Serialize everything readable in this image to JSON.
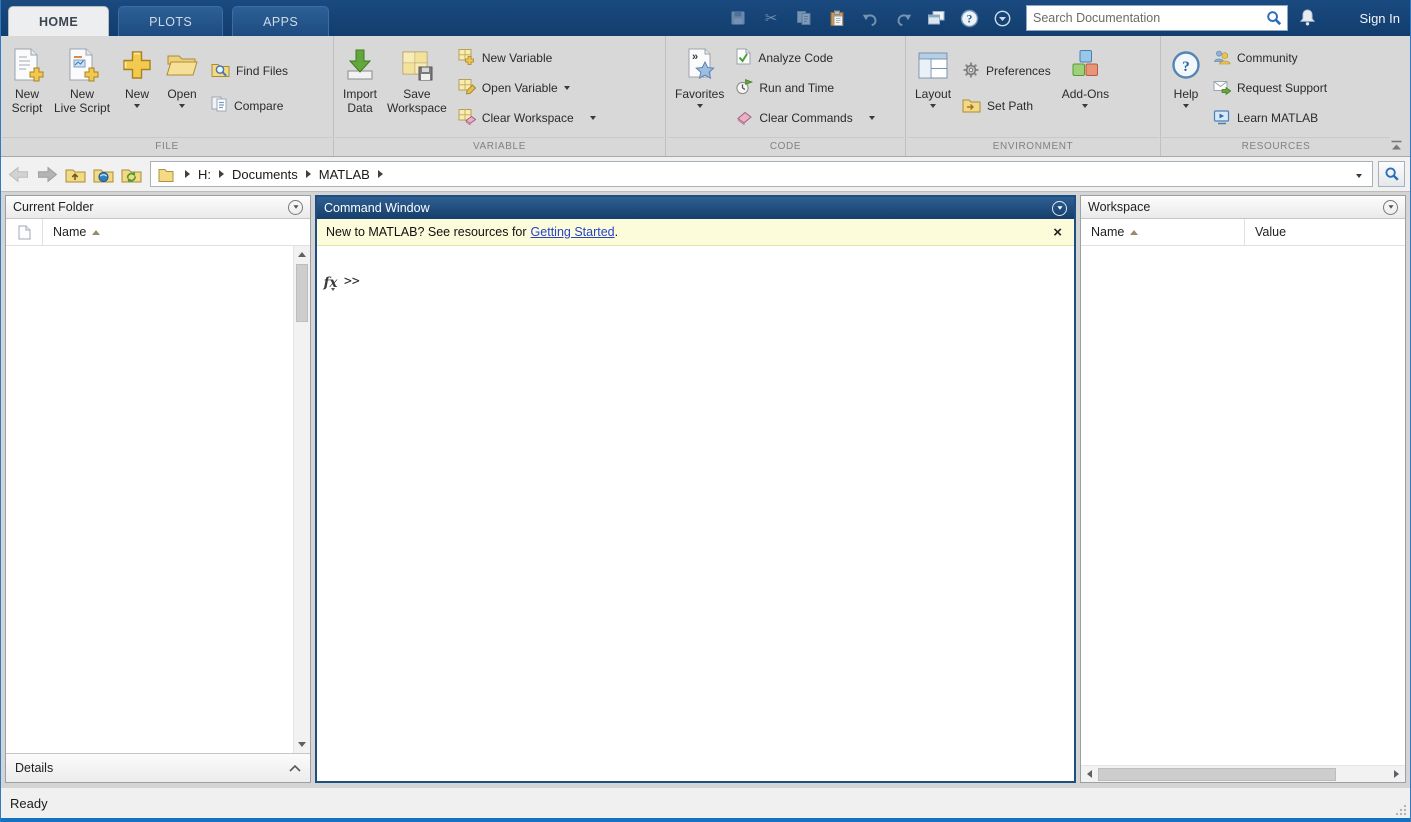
{
  "colors": {
    "titlebar_navy": "#134071",
    "inactive_tab_blue": "#245differ",
    "active_panel_border": "#1d4f80",
    "command_header_gradient_top": "#2e5f92",
    "banner_bg": "#fcfcdb",
    "link_blue": "#2742cc",
    "ribbon_bg": "#d8d8d8",
    "statusbar_strip_blue": "#1272c4"
  },
  "icons": {
    "save-icon": "floppy-disk",
    "cut-icon": "scissors",
    "copy-icon": "two-pages",
    "paste-icon": "clipboard",
    "undo-icon": "curved-arrow-left",
    "redo-icon": "curved-arrow-right",
    "new-window-icon": "stacked-windows",
    "help-circle-icon": "question-circle",
    "toolbar-menu-icon": "circle-caret-down",
    "search-icon": "magnifier",
    "bell-icon": "bell",
    "back-icon": "thick-arrow-left",
    "forward-icon": "thick-arrow-right",
    "up-one-level-icon": "folder-up-arrow",
    "browse-folder-icon": "folder-globe",
    "refresh-folder-icon": "folder-refresh",
    "folder-icon": "yellow-folder",
    "new-script-icon": "document-plus",
    "new-live-script-icon": "document-color-plus",
    "new-icon": "big-yellow-plus",
    "open-icon": "open-folder",
    "find-files-icon": "folder-magnifier",
    "compare-icon": "two-documents",
    "import-data-icon": "green-down-arrow-tray",
    "save-workspace-icon": "grid-floppy",
    "new-variable-icon": "grid-plus",
    "open-variable-icon": "grid-pencil",
    "clear-workspace-icon": "grid-eraser",
    "favorites-icon": "document-star",
    "analyze-code-icon": "document-check",
    "run-and-time-icon": "stopwatch-flag",
    "clear-commands-icon": "eraser",
    "layout-icon": "window-panes",
    "preferences-icon": "gear",
    "set-path-icon": "folder-path",
    "add-ons-icon": "three-cubes",
    "help-icon": "question-circle-large",
    "community-icon": "two-people",
    "request-support-icon": "envelope-arrow",
    "learn-matlab-icon": "monitor-play",
    "panel-menu-icon": "circle-caret-down",
    "sort-ascending-icon": "up-triangle",
    "minimize-ribbon-icon": "bar-up-triangle",
    "details-collapse-icon": "chevron-up",
    "fx-icon": "function-fx"
  },
  "tab_bar": {
    "tabs": [
      {
        "label": "HOME",
        "active": true
      },
      {
        "label": "PLOTS",
        "active": false
      },
      {
        "label": "APPS",
        "active": false
      }
    ],
    "search_placeholder": "Search Documentation",
    "sign_in_label": "Sign In"
  },
  "ribbon": {
    "file": {
      "label": "FILE",
      "new_script_l1": "New",
      "new_script_l2": "Script",
      "new_live_script_l1": "New",
      "new_live_script_l2": "Live Script",
      "new_label": "New",
      "open_label": "Open",
      "find_files": "Find Files",
      "compare": "Compare"
    },
    "variable": {
      "label": "VARIABLE",
      "import_l1": "Import",
      "import_l2": "Data",
      "save_l1": "Save",
      "save_l2": "Workspace",
      "new_variable": "New Variable",
      "open_variable": "Open Variable",
      "clear_workspace": "Clear Workspace"
    },
    "code": {
      "label": "CODE",
      "favorites": "Favorites",
      "analyze_code": "Analyze Code",
      "run_and_time": "Run and Time",
      "clear_commands": "Clear Commands"
    },
    "environment": {
      "label": "ENVIRONMENT",
      "layout": "Layout",
      "preferences": "Preferences",
      "set_path": "Set Path",
      "add_ons": "Add-Ons"
    },
    "resources": {
      "label": "RESOURCES",
      "help": "Help",
      "community": "Community",
      "request_support": "Request Support",
      "learn_matlab": "Learn MATLAB"
    }
  },
  "address_bar": {
    "segments": [
      "H:",
      "Documents",
      "MATLAB"
    ]
  },
  "current_folder": {
    "title": "Current Folder",
    "column_name": "Name",
    "details_label": "Details"
  },
  "command_window": {
    "title": "Command Window",
    "banner_prefix": "New to MATLAB? See resources for",
    "banner_link": "Getting Started",
    "banner_suffix": ".",
    "close_label": "×",
    "fx_label": "fx",
    "prompt": ">>"
  },
  "workspace": {
    "title": "Workspace",
    "column_name": "Name",
    "column_value": "Value"
  },
  "status_bar": {
    "ready_label": "Ready"
  }
}
